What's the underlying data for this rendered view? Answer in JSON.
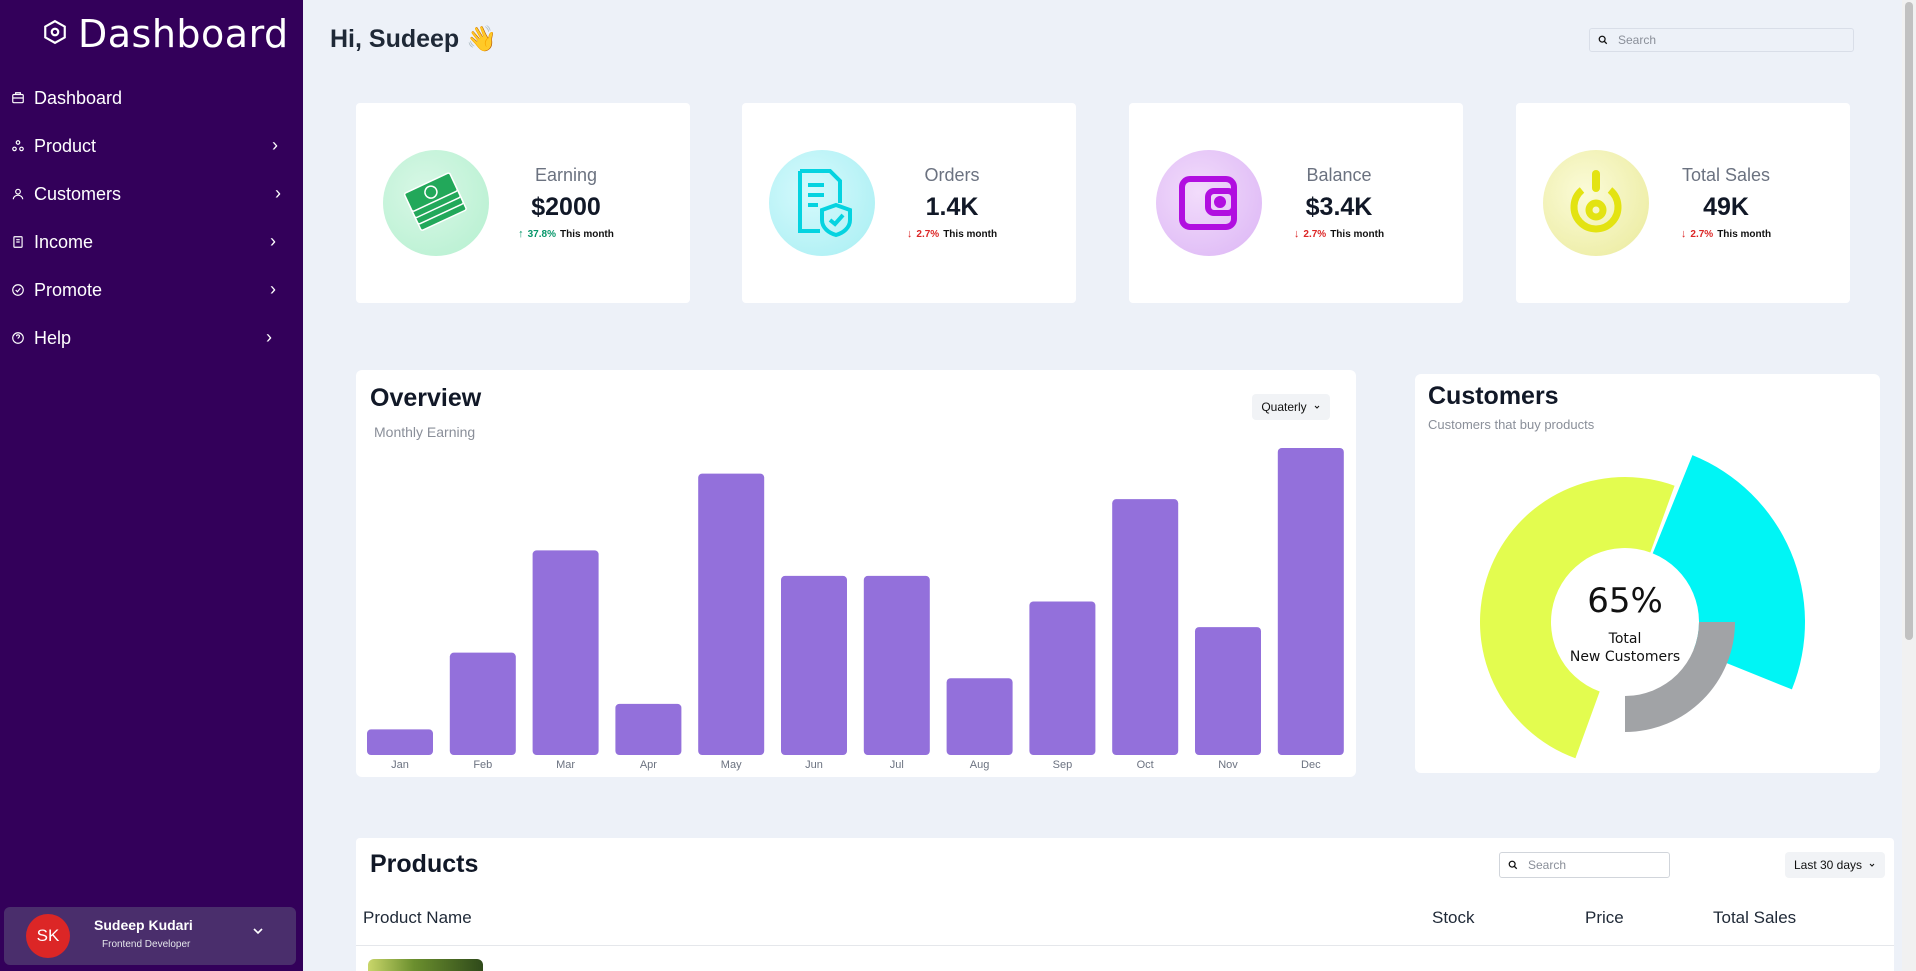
{
  "sidebar": {
    "brand": "Dashboard",
    "items": [
      {
        "label": "Dashboard",
        "icon": "dashboard-icon",
        "chevron": false
      },
      {
        "label": "Product",
        "icon": "product-icon",
        "chevron": true
      },
      {
        "label": "Customers",
        "icon": "user-icon",
        "chevron": true
      },
      {
        "label": "Income",
        "icon": "wallet-icon",
        "chevron": true
      },
      {
        "label": "Promote",
        "icon": "promote-icon",
        "chevron": true
      },
      {
        "label": "Help",
        "icon": "help-icon",
        "chevron": true
      }
    ],
    "user": {
      "initials": "SK",
      "name": "Sudeep Kudari",
      "role": "Frontend Developer"
    }
  },
  "header": {
    "greeting": "Hi, Sudeep 👋",
    "search_placeholder": "Search"
  },
  "stats": [
    {
      "label": "Earning",
      "value": "$2000",
      "trend": "37.8%",
      "trend_text": "This month",
      "direction": "up",
      "trend_color": "#059669",
      "icon": "money-icon",
      "icon_color": "#16a34a"
    },
    {
      "label": "Orders",
      "value": "1.4K",
      "trend": "2.7%",
      "trend_text": "This month",
      "direction": "down",
      "trend_color": "#dc2626",
      "icon": "document-shield-icon",
      "icon_color": "#06d6e0"
    },
    {
      "label": "Balance",
      "value": "$3.4K",
      "trend": "2.7%",
      "trend_text": "This month",
      "direction": "down",
      "trend_color": "#dc2626",
      "icon": "wallet-icon",
      "icon_color": "#c026d3"
    },
    {
      "label": "Total Sales",
      "value": "49K",
      "trend": "2.7%",
      "trend_text": "This month",
      "direction": "down",
      "trend_color": "#dc2626",
      "icon": "power-icon",
      "icon_color": "#e2e20c"
    }
  ],
  "overview": {
    "title": "Overview",
    "subtitle": "Monthly Earning",
    "period": "Quaterly"
  },
  "chart_data": [
    {
      "type": "bar",
      "categories": [
        "Jan",
        "Feb",
        "Mar",
        "Apr",
        "May",
        "Jun",
        "Jul",
        "Aug",
        "Sep",
        "Oct",
        "Nov",
        "Dec"
      ],
      "values": [
        1,
        4,
        8,
        2,
        11,
        7,
        7,
        3,
        6,
        10,
        5,
        12
      ],
      "ylim": [
        0,
        12
      ],
      "bar_color": "#9370db",
      "grid": false
    },
    {
      "type": "pie",
      "title": "Customers",
      "subtitle": "Customers that buy products",
      "center_value": "65%",
      "center_label_1": "Total",
      "center_label_2": "New Customers",
      "slices": [
        {
          "value": 25,
          "color": "#00f5f5"
        },
        {
          "value": 25,
          "color": "#a1a3a6"
        },
        {
          "value": 50,
          "color": "#e3fc4f"
        }
      ]
    }
  ],
  "products": {
    "title": "Products",
    "search_placeholder": "Search",
    "period": "Last 30 days",
    "columns": [
      "Product Name",
      "Stock",
      "Price",
      "Total Sales"
    ]
  }
}
